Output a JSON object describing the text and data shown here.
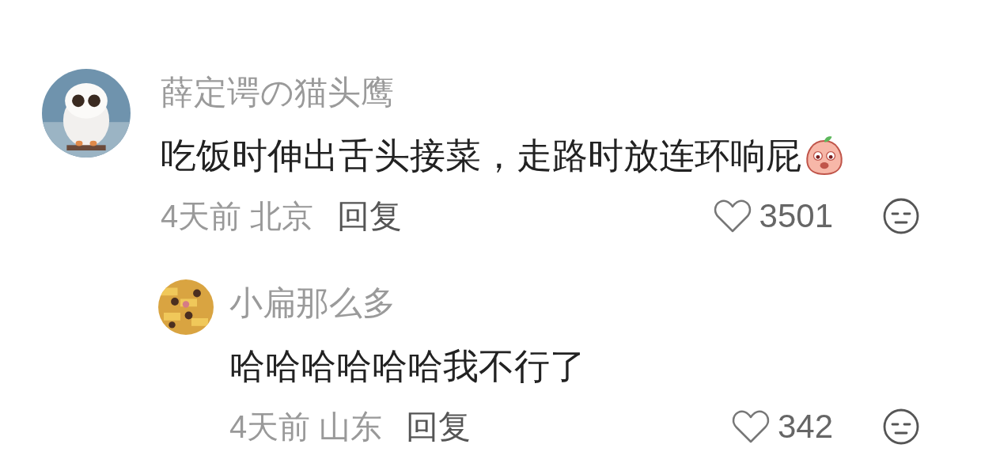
{
  "comments": [
    {
      "author": "薛定谔の猫头鹰",
      "text": "吃饭时伸出舌头接菜，走路时放连环响屁",
      "has_emoji": true,
      "time": "4天前",
      "location": "北京",
      "reply": "回复",
      "likes": "3501",
      "liked": false,
      "replies": [
        {
          "author": "小扁那么多",
          "text": "哈哈哈哈哈哈我不行了",
          "has_emoji": false,
          "time": "4天前",
          "location": "山东",
          "reply": "回复",
          "likes": "342",
          "liked": false
        }
      ]
    }
  ]
}
